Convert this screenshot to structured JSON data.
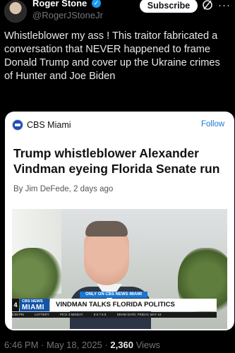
{
  "author": {
    "name": "Roger Stone",
    "handle": "@RogerJStoneJr",
    "subscribe_label": "Subscribe"
  },
  "icons": {
    "verified": "verified-badge-icon",
    "grok": "grok-icon",
    "more": "more-icon"
  },
  "tweet": {
    "text": "Whistleblower my ass ! This traitor fabricated a conversation that NEVER happened to frame Donald Trump and cover up the Ukraine crimes of Hunter and Joe Biden"
  },
  "card": {
    "source": "CBS Miami",
    "follow_label": "Follow",
    "headline": "Trump whistleblower Alexander Vindman eyeing Florida Senate run",
    "byline": "By Jim DeFede, 2 days ago",
    "broadcast": {
      "banner": "ONLY ON CBS NEWS MIAMI",
      "channel": "4",
      "logo_line1": "CBS NEWS",
      "logo_line2": "MIAMI",
      "headline": "VINDMAN TALKS FLORIDA POLITICS",
      "ticker": [
        "6:59 PM",
        "LOTTERY",
        "PICK 3 MIDDAY",
        "8 6 7 6 5",
        "DRAW DATE: FRIDAY, MAY 16"
      ]
    }
  },
  "meta": {
    "time": "6:46 PM",
    "date": "May 18, 2025",
    "separator": "·",
    "views_count": "2,360",
    "views_label": "Views"
  },
  "colors": {
    "background": "#000000",
    "verified": "#1d9bf0",
    "follow": "#1f78d1",
    "muted": "#71767b"
  }
}
